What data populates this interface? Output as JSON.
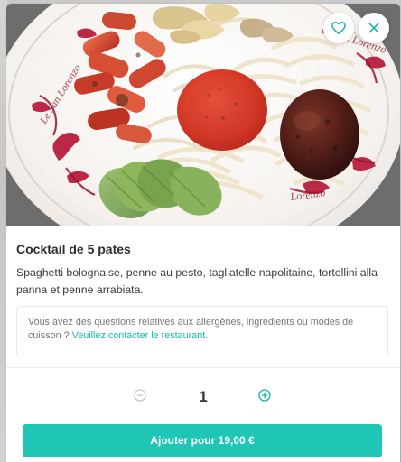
{
  "item": {
    "title": "Cocktail de 5 pates",
    "description": "Spaghetti bolognaise, penne au pesto, tagliatelle napolitaine, tortellini alla panna et penne arrabiata."
  },
  "allergen_notice": {
    "text": "Vous avez des questions relatives aux allergènes, ingrédients ou modes de cuisson ?",
    "link_text": "Veuillez contacter le restaurant."
  },
  "quantity": {
    "value": "1"
  },
  "cta": {
    "label": "Ajouter pour 19,00 €"
  },
  "icons": {
    "favorite": "heart-icon",
    "close": "close-icon",
    "decrement": "minus-circle-icon",
    "increment": "plus-circle-icon"
  },
  "colors": {
    "accent": "#1fc6b5",
    "link": "#16b9ab",
    "text": "#2f2f2f",
    "muted_text": "#767676",
    "disabled_icon": "#c7c7c7",
    "border": "#e8e8e8"
  },
  "plate_border_text": "Le San Lorenzo"
}
